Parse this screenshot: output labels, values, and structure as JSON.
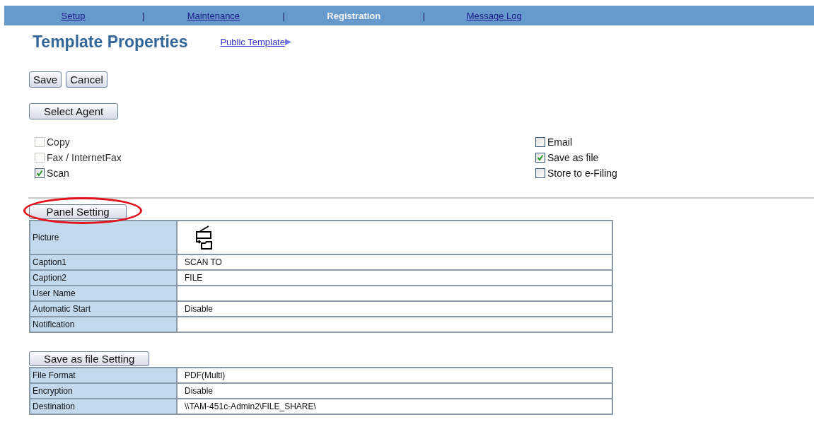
{
  "nav": [
    {
      "label": "Setup",
      "selected": false
    },
    {
      "label": "Maintenance",
      "selected": false
    },
    {
      "label": "Registration",
      "selected": true
    },
    {
      "label": "Message Log",
      "selected": false
    }
  ],
  "nav_separator": "|",
  "title": "Template Properties",
  "public_template_link": "Public Template",
  "buttons": [
    "Save",
    "Cancel"
  ],
  "select_agent_button": "Select Agent",
  "agents_left": [
    {
      "label": "Copy",
      "checked": false,
      "disabled": true
    },
    {
      "label": "Fax / InternetFax",
      "checked": false,
      "disabled": true
    },
    {
      "label": "Scan",
      "checked": true,
      "disabled": false
    }
  ],
  "agents_right": [
    {
      "label": "Email",
      "checked": false,
      "disabled": false
    },
    {
      "label": "Save as file",
      "checked": true,
      "disabled": false
    },
    {
      "label": "Store to e-Filing",
      "checked": false,
      "disabled": false
    }
  ],
  "sections": [
    {
      "button": "Panel Setting",
      "highlighted": true,
      "rows": [
        {
          "kind": "picture",
          "label": "Picture"
        },
        {
          "kind": "text",
          "label": "Caption1",
          "value": "SCAN TO"
        },
        {
          "kind": "text",
          "label": "Caption2",
          "value": "FILE"
        },
        {
          "kind": "text",
          "label": "User Name"
        },
        {
          "kind": "text",
          "label": "Automatic Start",
          "value": "Disable"
        },
        {
          "kind": "text",
          "label": "Notification"
        }
      ]
    },
    {
      "button": "Save as file Setting",
      "highlighted": false,
      "rows": [
        {
          "kind": "text",
          "label": "File Format",
          "value": "PDF(Multi)"
        },
        {
          "kind": "text",
          "label": "Encryption",
          "value": "Disable"
        },
        {
          "kind": "text",
          "label": "Destination",
          "value": "\\\\TAM-451c-Admin2\\FILE_SHARE\\"
        }
      ]
    }
  ]
}
